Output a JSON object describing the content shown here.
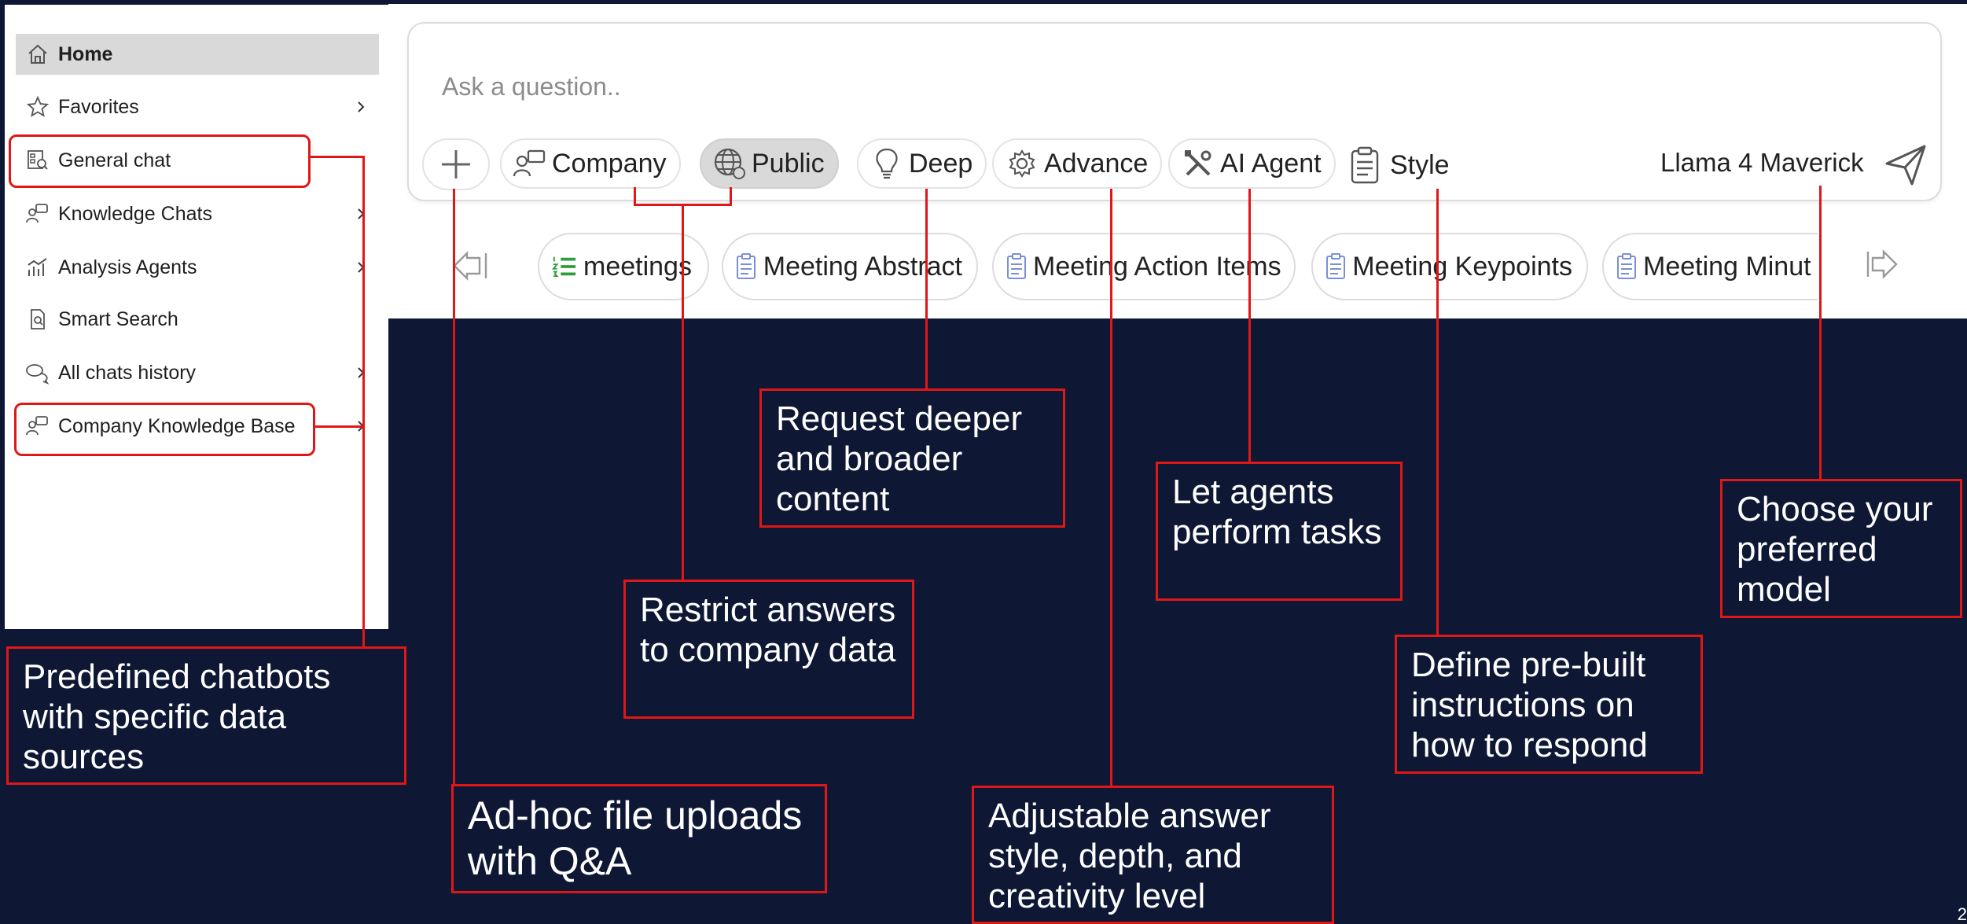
{
  "sidebar": {
    "items": [
      {
        "label": "Home",
        "icon": "home-icon"
      },
      {
        "label": "Favorites",
        "icon": "star-icon"
      },
      {
        "label": "General chat",
        "icon": "chat-search-icon"
      },
      {
        "label": "Knowledge Chats",
        "icon": "people-chat-icon"
      },
      {
        "label": "Analysis Agents",
        "icon": "bar-chart-icon"
      },
      {
        "label": "Smart Search",
        "icon": "document-search-icon"
      },
      {
        "label": "All chats history",
        "icon": "chat-bubbles-icon"
      },
      {
        "label": "Company Knowledge Base",
        "icon": "people-chat-icon"
      }
    ]
  },
  "chat": {
    "placeholder": "Ask a question..",
    "buttons": {
      "company": "Company",
      "public": "Public",
      "deep": "Deep",
      "advance": "Advance",
      "ai_agent": "AI Agent",
      "style": "Style"
    },
    "model": "Llama 4 Maverick"
  },
  "templates": [
    {
      "label": "meetings",
      "icon": "list-icon"
    },
    {
      "label": "Meeting Abstract",
      "icon": "clipboard-icon"
    },
    {
      "label": "Meeting Action Items",
      "icon": "clipboard-icon"
    },
    {
      "label": "Meeting Keypoints",
      "icon": "clipboard-icon"
    },
    {
      "label": "Meeting Minut",
      "icon": "clipboard-icon"
    }
  ],
  "callouts": {
    "chatbots": "Predefined chatbots with specific data sources",
    "upload": "Ad-hoc file uploads with Q&A",
    "company": "Restrict answers to company data",
    "deep": "Request deeper and broader content",
    "advance": "Adjustable answer style, depth, and creativity level",
    "agent": "Let agents perform tasks",
    "style": "Define pre-built instructions on how to respond",
    "model": "Choose your preferred model"
  },
  "page_number": "2",
  "colors": {
    "background": "#0e1734",
    "accent": "#e01717",
    "selected_pill": "#d9d9d9",
    "list_icon": "#2e9e3a",
    "clipboard_icon": "#7b8fd8"
  }
}
